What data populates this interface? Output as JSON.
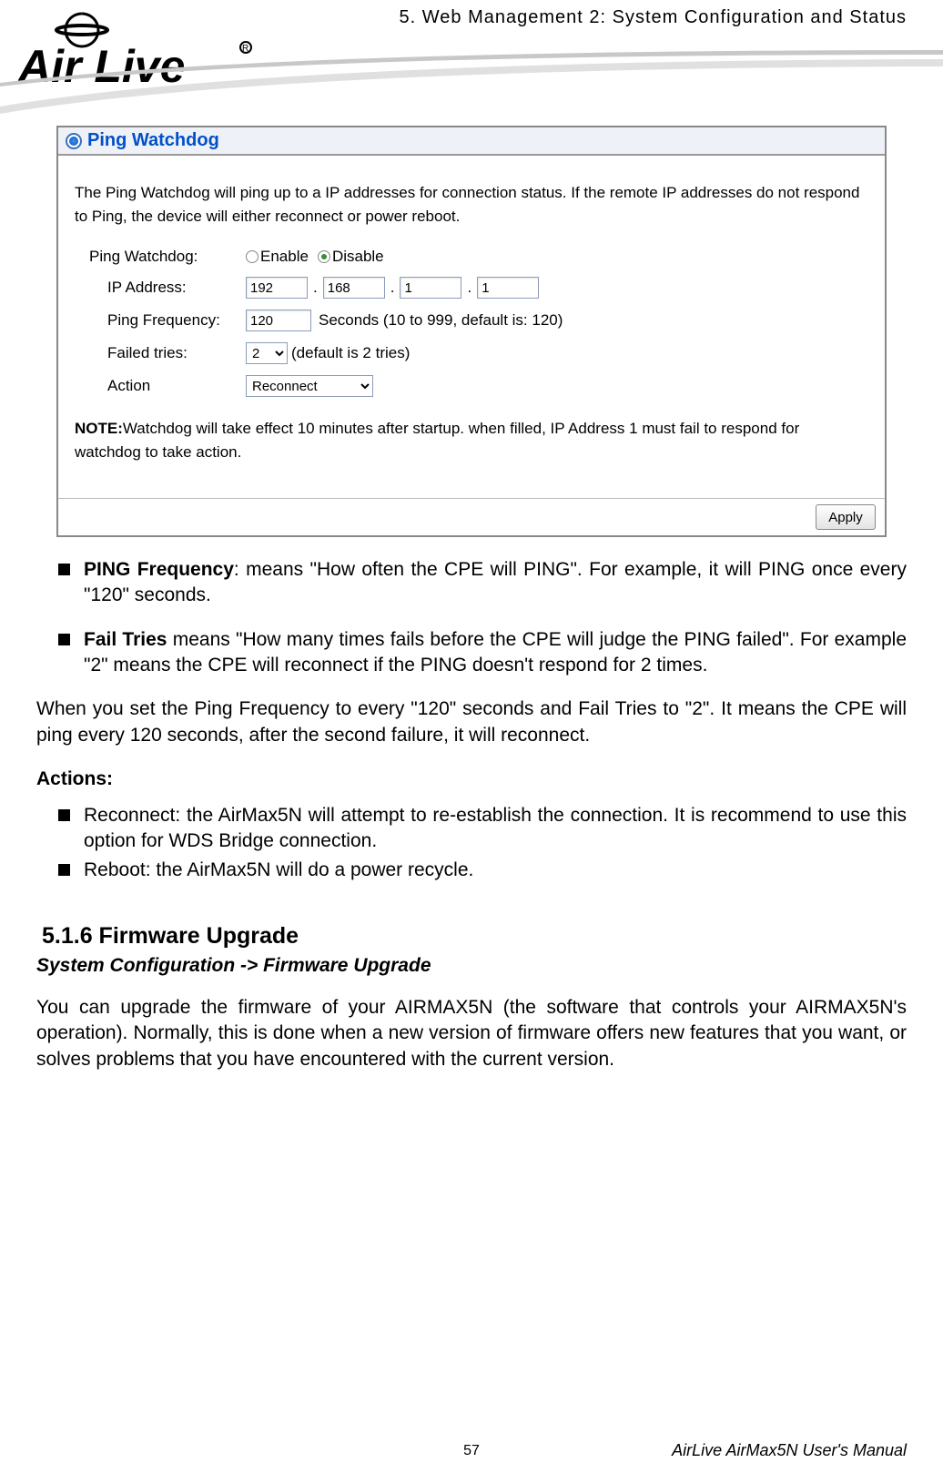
{
  "header": {
    "chapter": "5. Web Management 2: System Configuration and Status"
  },
  "panel": {
    "title": "Ping Watchdog",
    "description": "The Ping Watchdog will ping up to a IP addresses for connection status. If the remote IP addresses do not respond to Ping, the device will either reconnect or power reboot.",
    "labels": {
      "ping_watchdog": "Ping Watchdog:",
      "ip_address": "IP Address:",
      "ping_frequency": "Ping Frequency:",
      "failed_tries": "Failed tries:",
      "action": "Action"
    },
    "radio": {
      "enable": "Enable",
      "disable": "Disable"
    },
    "ip": {
      "a": "192",
      "b": "168",
      "c": "1",
      "d": "1"
    },
    "freq_value": "120",
    "freq_hint": "Seconds (10 to 999, default is: 120)",
    "failed_value": "2",
    "failed_hint": "(default is 2 tries)",
    "action_value": "Reconnect",
    "note_bold": "NOTE:",
    "note_text": "Watchdog will take effect 10 minutes after startup. when filled, IP Address 1 must fail to respond for watchdog to take action.",
    "apply": "Apply"
  },
  "bullets1": {
    "b1_bold": "PING Frequency",
    "b1_text": ": means \"How often the CPE will PING\". For example, it will PING once every \"120\" seconds.",
    "b2_bold": "Fail Tries",
    "b2_text": " means \"How many times fails before the CPE will judge the PING failed\". For example \"2\" means the CPE will reconnect if the PING doesn't respond for 2 times."
  },
  "paragraph1": "When you set the Ping Frequency to every \"120\" seconds and Fail Tries to \"2\". It means the CPE will ping every 120 seconds, after the second failure, it will reconnect.",
  "actions_heading": "Actions:",
  "bullets2": {
    "b1": "Reconnect: the AirMax5N will attempt to re-establish the connection. It is recommend to use this option for WDS Bridge connection.",
    "b2": "Reboot: the AirMax5N will do a power recycle."
  },
  "section": {
    "heading": "5.1.6 Firmware Upgrade",
    "sub": "System Configuration -> Firmware Upgrade",
    "text": "You can upgrade the firmware of your AIRMAX5N (the software that controls your AIRMAX5N's operation). Normally, this is done when a new version of firmware offers new features that you want, or solves problems that you have encountered with the current version."
  },
  "footer": {
    "page": "57",
    "manual": "AirLive AirMax5N User's Manual"
  }
}
